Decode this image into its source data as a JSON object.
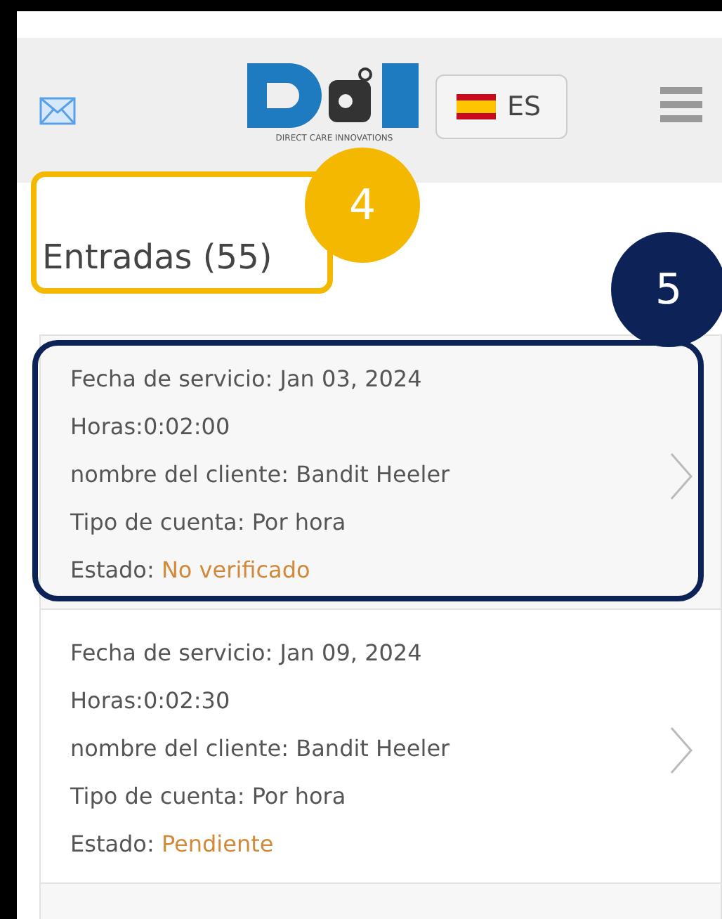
{
  "header": {
    "logo_tagline": "DIRECT CARE INNOVATIONS",
    "language": "ES"
  },
  "title": "Entradas (55)",
  "callouts": [
    {
      "number": "4"
    },
    {
      "number": "5"
    }
  ],
  "entries": [
    {
      "fields": [
        {
          "label": "Fecha de servicio:",
          "value": "Jan 03, 2024"
        },
        {
          "label": "Horas:",
          "value": "0:02:00"
        },
        {
          "label": "nombre del cliente:",
          "value": "Bandit Heeler"
        },
        {
          "label": "Tipo de cuenta:",
          "value": "Por hora"
        }
      ],
      "status_label": "Estado:",
      "status": "No verificado"
    },
    {
      "fields": [
        {
          "label": "Fecha de servicio:",
          "value": "Jan 09, 2024"
        },
        {
          "label": "Horas:",
          "value": "0:02:30"
        },
        {
          "label": "nombre del cliente:",
          "value": "Bandit Heeler"
        },
        {
          "label": "Tipo de cuenta:",
          "value": "Por hora"
        }
      ],
      "status_label": "Estado:",
      "status": "Pendiente"
    }
  ]
}
